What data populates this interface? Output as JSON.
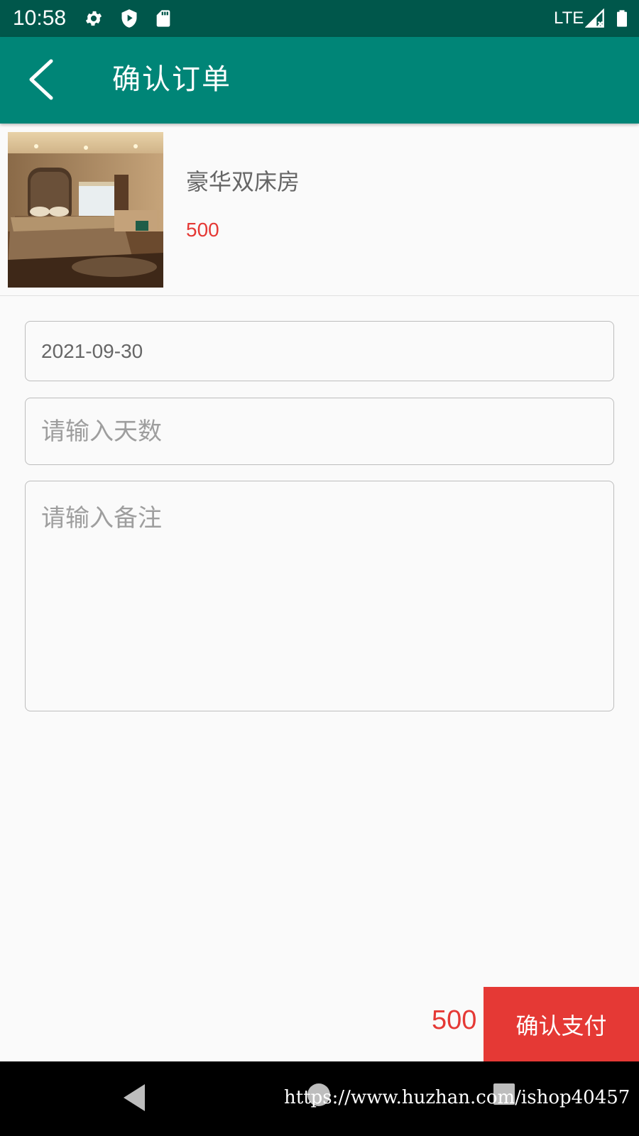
{
  "status_bar": {
    "time": "10:58",
    "network": "LTE",
    "icons": [
      "gear-icon",
      "shield-icon",
      "sd-card-icon",
      "signal-icon",
      "battery-icon"
    ]
  },
  "app_bar": {
    "title": "确认订单",
    "back_icon": "chevron-left-icon",
    "color": "#008577"
  },
  "room": {
    "name": "豪华双床房",
    "price": "500",
    "image": "hotel-room-photo"
  },
  "form": {
    "date_value": "2021-09-30",
    "days_placeholder": "请输入天数",
    "remark_placeholder": "请输入备注"
  },
  "footer": {
    "total": "500",
    "pay_label": "确认支付",
    "accent": "#e53935"
  },
  "nav_bar": {
    "watermark": "https://www.huzhan.com/ishop40457"
  }
}
